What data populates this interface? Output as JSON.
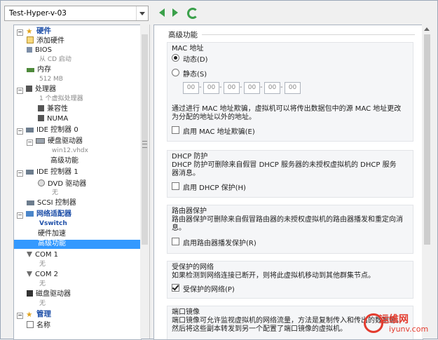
{
  "vm_selector": {
    "value": "Test-Hyper-v-03"
  },
  "tree": {
    "hardware_section": "硬件",
    "items": [
      {
        "name": "tree-add-hardware",
        "label": "添加硬件",
        "sub": ""
      },
      {
        "name": "tree-bios",
        "label": "BIOS",
        "sub": "从 CD 启动"
      },
      {
        "name": "tree-memory",
        "label": "内存",
        "sub": "512 MB"
      },
      {
        "name": "tree-processor",
        "label": "处理器",
        "sub": "1 个虚拟处理器"
      },
      {
        "name": "tree-compat",
        "label": "兼容性",
        "sub": ""
      },
      {
        "name": "tree-numa",
        "label": "NUMA",
        "sub": ""
      },
      {
        "name": "tree-ide0",
        "label": "IDE 控制器 0",
        "sub": ""
      },
      {
        "name": "tree-hdd",
        "label": "硬盘驱动器",
        "sub": "win12.vhdx"
      },
      {
        "name": "tree-hdd-advanced",
        "label": "高级功能",
        "sub": ""
      },
      {
        "name": "tree-ide1",
        "label": "IDE 控制器 1",
        "sub": ""
      },
      {
        "name": "tree-dvd",
        "label": "DVD 驱动器",
        "sub": "无"
      },
      {
        "name": "tree-scsi",
        "label": "SCSI 控制器",
        "sub": ""
      },
      {
        "name": "tree-nic",
        "label": "网络适配器",
        "sub": "Vswitch"
      },
      {
        "name": "tree-hw-accel",
        "label": "硬件加速",
        "sub": ""
      },
      {
        "name": "tree-nic-advanced",
        "label": "高级功能",
        "sub": ""
      },
      {
        "name": "tree-com1",
        "label": "COM 1",
        "sub": "无"
      },
      {
        "name": "tree-com2",
        "label": "COM 2",
        "sub": "无"
      },
      {
        "name": "tree-floppy",
        "label": "磁盘驱动器",
        "sub": "无"
      }
    ],
    "management_section": "管理",
    "management_items": [
      {
        "label": "名称"
      }
    ]
  },
  "panel": {
    "title": "高级功能",
    "mac": {
      "title": "MAC 地址",
      "dynamic_label": "动态(D)",
      "static_label": "静态(S)",
      "octets": [
        "00",
        "00",
        "00",
        "00",
        "00",
        "00"
      ],
      "description": "通过进行 MAC 地址欺骗，虚拟机可以将传出数据包中的源 MAC 地址更改为分配的地址以外的地址。",
      "spoof_label": "启用 MAC 地址欺骗(E)"
    },
    "dhcp": {
      "title": "DHCP 防护",
      "description": "DHCP 防护可删除来自假冒 DHCP 服务器的未授权虚拟机的 DHCP 服务器消息。",
      "enable_label": "启用 DHCP 保护(H)"
    },
    "router": {
      "title": "路由器保护",
      "description": "路由器保护可删除来自假冒路由器的未授权虚拟机的路由器播发和重定向消息。",
      "enable_label": "启用路由器播发保护(R)"
    },
    "protected": {
      "title": "受保护的网络",
      "description": "如果检测到网络连接已断开，则将此虚拟机移动到其他群集节点。",
      "enable_label": "受保护的网络(P)"
    },
    "mirroring": {
      "title": "端口镜像",
      "description": "端口镜像可允许监视虚拟机的网络流量，方法是复制传入和传出的数据包，然后将这些副本转发到另一个配置了端口镜像的虚拟机。"
    }
  },
  "watermark": {
    "line1": "运维网",
    "line2": "iyunv.com"
  },
  "colors": {
    "accent": "#3399ff",
    "section": "#1e4fa8",
    "nav_green": "#3aa04a"
  }
}
